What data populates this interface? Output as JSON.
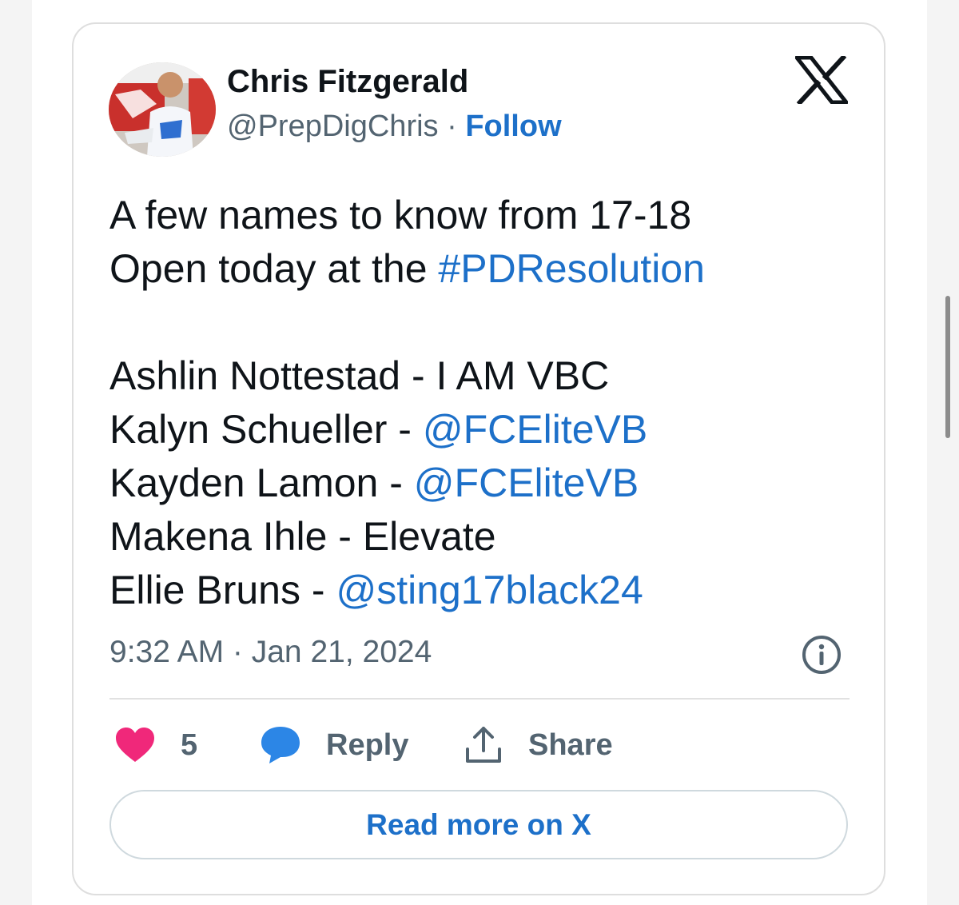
{
  "tweet": {
    "author_name": "Chris Fitzgerald",
    "handle": "@PrepDigChris",
    "separator": "·",
    "follow_label": "Follow",
    "logo_icon": "x-logo-icon",
    "body": {
      "line1": "A few names to know from 17-18",
      "line2_text": "Open today at the ",
      "line2_hashtag": "#PDResolution",
      "players": [
        {
          "text": "Ashlin Nottestad - I AM VBC",
          "link": ""
        },
        {
          "text": "Kalyn Schueller - ",
          "link": "@FCEliteVB"
        },
        {
          "text": "Kayden Lamon - ",
          "link": "@FCEliteVB"
        },
        {
          "text": "Makena Ihle - Elevate",
          "link": ""
        },
        {
          "text": "Ellie Bruns - ",
          "link": "@sting17black24"
        }
      ]
    },
    "timestamp": "9:32 AM · Jan 21, 2024",
    "actions": {
      "like_count": "5",
      "reply_label": "Reply",
      "share_label": "Share"
    },
    "read_more_label": "Read more on X"
  },
  "colors": {
    "link": "#1d70c9",
    "text": "#0f1419",
    "muted": "#536471",
    "heart": "#f0287a",
    "reply_bubble": "#2c86e6",
    "border": "#cfd9de"
  }
}
